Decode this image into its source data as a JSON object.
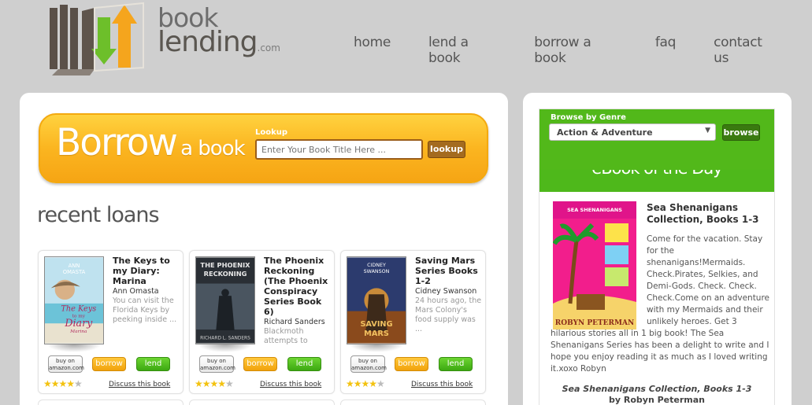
{
  "header": {
    "logo": {
      "word1": "book",
      "word2": "lending",
      "suffix": ".com"
    },
    "nav": [
      "home",
      "lend a book",
      "borrow a book",
      "faq",
      "contact us"
    ]
  },
  "borrow": {
    "title_big": "Borrow",
    "title_small": "a book",
    "lookup_label": "Lookup",
    "lookup_placeholder": "Enter Your Book Title Here ...",
    "lookup_button": "lookup"
  },
  "recent": {
    "heading": "recent loans",
    "books": [
      {
        "title": "The Keys to my Diary: Marina",
        "author": "Ann Omasta",
        "desc": "You can visit the Florida Keys by peeking inside ...",
        "rating": 4.5,
        "cover_text": [
          "ANN",
          "OMASTA",
          "The Keys",
          "to my",
          "Diary",
          "Marina"
        ]
      },
      {
        "title": "The Phoenix Reckoning (The Phoenix Conspiracy Series Book 6)",
        "author": "Richard Sanders",
        "desc": "Blackmoth attempts to",
        "rating": 4,
        "cover_text": [
          "THE PHOENIX",
          "RECKONING",
          "RICHARD L. SANDERS"
        ]
      },
      {
        "title": "Saving Mars Series Books 1-2",
        "author": "Cidney Swanson",
        "desc": "24 hours ago, the Mars Colony's food supply was ...",
        "rating": 4.5,
        "cover_text": [
          "CIDNEY",
          "SWANSON",
          "SAVING",
          "MARS"
        ]
      }
    ],
    "amazon_label": [
      "buy on",
      "amazon.com"
    ],
    "borrow_label": "borrow",
    "lend_label": "lend",
    "discuss_label": "Discuss this book"
  },
  "sidebar": {
    "genre_label": "Browse by Genre",
    "genre_selected": "Action & Adventure",
    "browse_button": "browse",
    "eotd_title": "eBook of the Day",
    "featured": {
      "title": "Sea Shenanigans Collection, Books 1-3",
      "description": "Come for the vacation. Stay for the shenanigans!Mermaids. Check.Pirates, Selkies, and Demi-Gods. Check. Check. Check.Come on an adventure with my Mermaids and their unlikely heroes. Get 3 hilarious stories all in 1 big book! The Sea Shenanigans Series has been a delight to write and I hope you enjoy reading it as much as I loved writing it.xoxo Robyn",
      "foot_title": "Sea Shenanigans Collection, Books 1-3",
      "foot_author": "by Robyn Peterman",
      "cover_text": [
        "SEA SHENANIGANS",
        "ROBYN PETERMAN"
      ]
    }
  },
  "colors": {
    "orange": "#fbb520",
    "green": "#52b81a",
    "background": "#cfcfcf"
  }
}
